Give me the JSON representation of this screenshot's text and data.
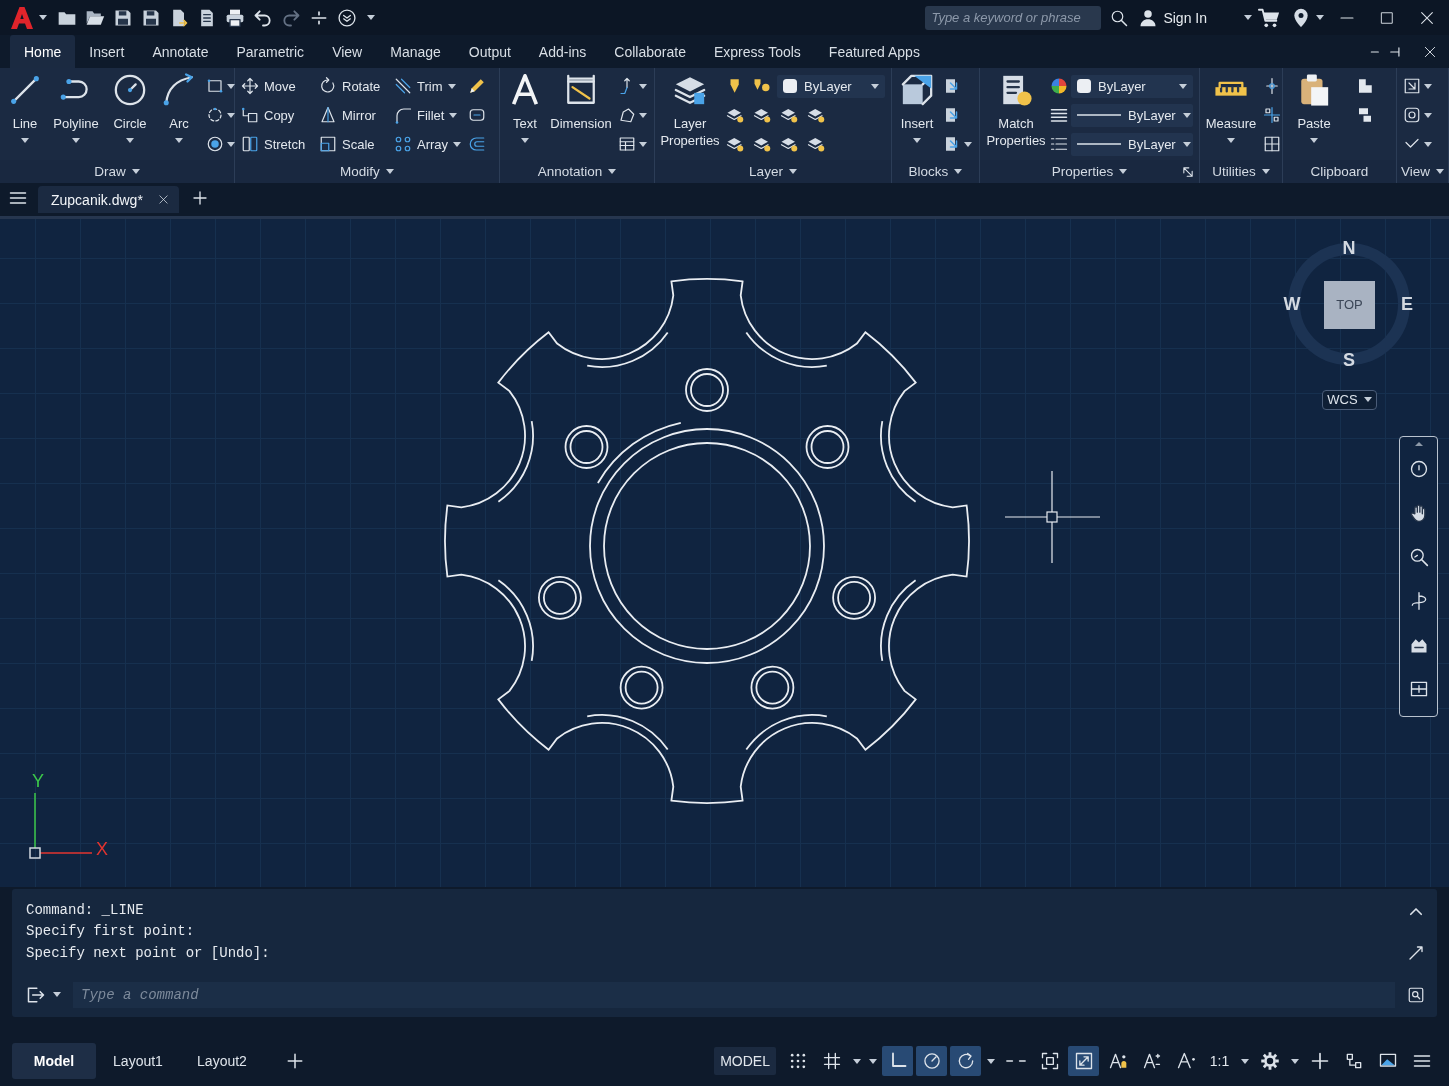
{
  "title_bar": {
    "search": {
      "placeholder": "Type a keyword or phrase"
    },
    "sign_in": "Sign In"
  },
  "ribbon": {
    "tabs": [
      {
        "label": "Home",
        "selected": true
      },
      {
        "label": "Insert",
        "selected": false
      },
      {
        "label": "Annotate",
        "selected": false
      },
      {
        "label": "Parametric",
        "selected": false
      },
      {
        "label": "View",
        "selected": false
      },
      {
        "label": "Manage",
        "selected": false
      },
      {
        "label": "Output",
        "selected": false
      },
      {
        "label": "Add-ins",
        "selected": false
      },
      {
        "label": "Collaborate",
        "selected": false
      },
      {
        "label": "Express Tools",
        "selected": false
      },
      {
        "label": "Featured Apps",
        "selected": false
      }
    ],
    "panels": [
      {
        "kind": "draw",
        "title": "Draw",
        "has_menu": true,
        "tools": [
          "Line",
          "Polyline",
          "Circle",
          "Arc"
        ]
      },
      {
        "kind": "modify",
        "title": "Modify",
        "has_menu": true,
        "tools": [
          "Move",
          "Rotate",
          "Trim",
          "Copy",
          "Mirror",
          "Fillet",
          "Stretch",
          "Scale",
          "Array"
        ]
      },
      {
        "kind": "annotation",
        "title": "Annotation",
        "has_menu": true,
        "tools": [
          "Text",
          "Dimension"
        ]
      },
      {
        "kind": "layer",
        "title": "Layer",
        "has_menu": true,
        "tools": [
          "Layer Properties"
        ],
        "dropdowns": [
          "ByLayer"
        ]
      },
      {
        "kind": "blocks",
        "title": "Blocks",
        "has_menu": true,
        "tools": [
          "Insert"
        ]
      },
      {
        "kind": "properties",
        "title": "Properties",
        "has_menu": true,
        "tools": [
          "Match Properties"
        ],
        "dropdowns": [
          "ByLayer",
          "ByLayer",
          "ByLayer"
        ]
      },
      {
        "kind": "utilities",
        "title": "Utilities",
        "has_menu": true,
        "tools": [
          "Measure"
        ]
      },
      {
        "kind": "clipboard",
        "title": "Clipboard",
        "has_menu": false,
        "tools": [
          "Paste"
        ]
      },
      {
        "kind": "view",
        "title": "View",
        "has_menu": true
      }
    ]
  },
  "file_tabs": [
    {
      "label": "Zupcanik.dwg*",
      "selected": true
    }
  ],
  "viewport": {
    "viewcube": {
      "face": "TOP",
      "north": "N",
      "east": "E",
      "south": "S",
      "west": "W"
    },
    "coordinate_system": "WCS",
    "ucs": {
      "x_label": "X",
      "y_label": "Y"
    }
  },
  "command_line": {
    "history": [
      "Command: _LINE",
      "Specify first point:",
      "Specify next point or [Undo]:"
    ],
    "placeholder": "Type a command"
  },
  "status_bar": {
    "layout_tabs": [
      {
        "label": "Model",
        "selected": true
      },
      {
        "label": "Layout1",
        "selected": false
      },
      {
        "label": "Layout2",
        "selected": false
      }
    ],
    "space": "MODEL",
    "items": [
      {
        "kind": "grid",
        "on": false
      },
      {
        "kind": "snap",
        "on": false
      },
      {
        "kind": "ortho",
        "on": true
      },
      {
        "kind": "polar",
        "on": true
      },
      {
        "kind": "osnap",
        "on": true
      },
      {
        "kind": "dashes",
        "on": false
      },
      {
        "kind": "cycling",
        "on": false
      },
      {
        "kind": "monitor",
        "on": true
      },
      {
        "kind": "visibility",
        "on": false
      },
      {
        "kind": "autoscale",
        "on": false
      },
      {
        "kind": "annoscale",
        "on": false
      },
      {
        "kind": "scale",
        "label": "1:1",
        "on": false
      },
      {
        "kind": "settings",
        "on": false
      },
      {
        "kind": "plus",
        "on": false
      },
      {
        "kind": "isolate",
        "on": false
      },
      {
        "kind": "graphics",
        "on": false
      },
      {
        "kind": "customize",
        "on": false
      }
    ]
  }
}
